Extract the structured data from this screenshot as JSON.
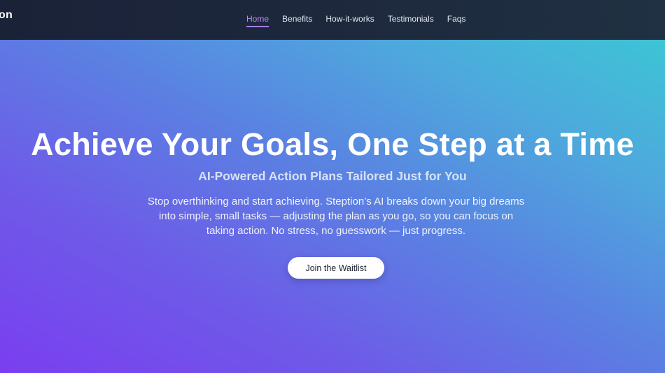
{
  "navbar": {
    "brand": "on",
    "links": [
      {
        "label": "Home",
        "active": true
      },
      {
        "label": "Benefits",
        "active": false
      },
      {
        "label": "How-it-works",
        "active": false
      },
      {
        "label": "Testimonials",
        "active": false
      },
      {
        "label": "Faqs",
        "active": false
      }
    ]
  },
  "hero": {
    "headline": "Achieve Your Goals, One Step at a Time",
    "subheadline": "AI-Powered Action Plans Tailored Just for You",
    "description": "Stop overthinking and start achieving. Steption’s AI breaks down your big dreams into simple, small tasks — adjusting the plan as you go, so you can focus on taking action. No stress, no guesswork — just progress.",
    "cta_label": "Join the Waitlist"
  },
  "colors": {
    "navbar_bg": "#1e293d",
    "active_link": "#b98cf4",
    "hero_gradient_start": "#7a3ef0",
    "hero_gradient_end": "#3dc4d5",
    "cta_bg": "#ffffff"
  }
}
